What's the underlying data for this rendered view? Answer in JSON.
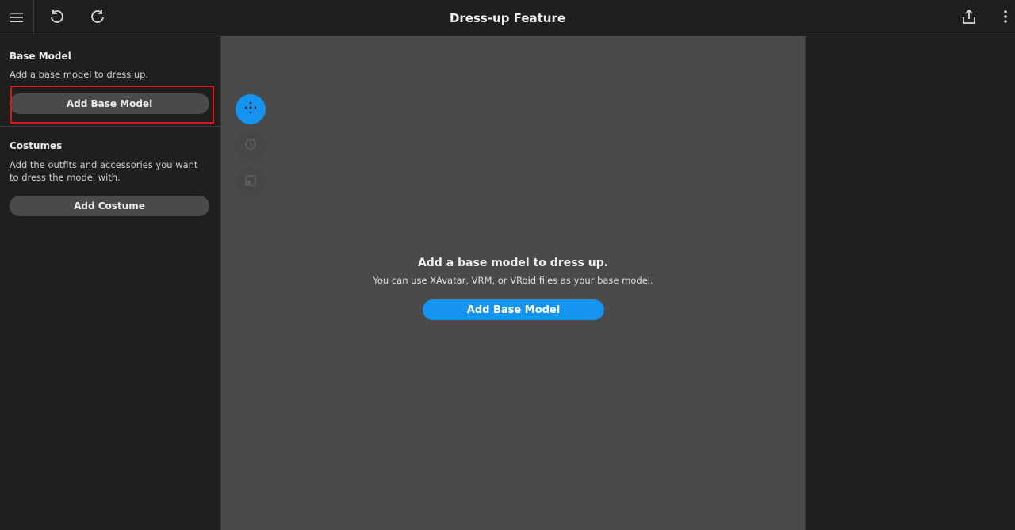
{
  "header": {
    "title": "Dress-up Feature",
    "icons": {
      "menu": "hamburger-menu-icon",
      "undo": "undo-icon",
      "redo": "redo-icon",
      "share": "share-export-icon",
      "more": "more-vertical-icon"
    }
  },
  "sidebar": {
    "base_model": {
      "title": "Base Model",
      "description": "Add a base model to dress up.",
      "button_label": "Add Base Model"
    },
    "costumes": {
      "title": "Costumes",
      "description": "Add the outfits and accessories you want to dress the model with.",
      "button_label": "Add Costume"
    }
  },
  "viewport": {
    "tools": [
      {
        "name": "move-tool-icon",
        "state": "active"
      },
      {
        "name": "rotate-tool-icon",
        "state": "disabled"
      },
      {
        "name": "pose-tool-icon",
        "state": "disabled"
      }
    ],
    "empty_title": "Add a base model to dress up.",
    "empty_subtitle": "You can use XAvatar, VRM, or VRoid files as your base model.",
    "button_label": "Add Base Model"
  },
  "colors": {
    "accent": "#1593F0",
    "highlight": "#E0141A",
    "viewport_bg": "#4A4A4A",
    "panel_bg": "#1F1F1F"
  }
}
